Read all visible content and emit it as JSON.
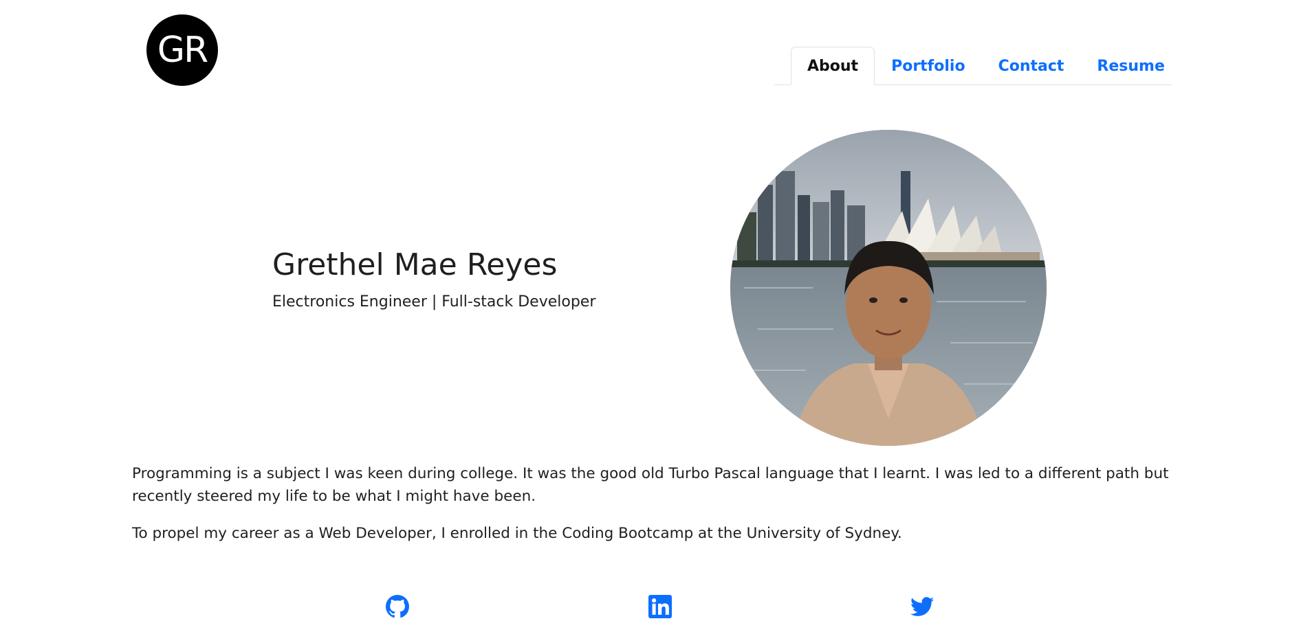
{
  "header": {
    "logo_text": "GR",
    "nav": [
      {
        "label": "About",
        "active": true
      },
      {
        "label": "Portfolio",
        "active": false
      },
      {
        "label": "Contact",
        "active": false
      },
      {
        "label": "Resume",
        "active": false
      }
    ]
  },
  "hero": {
    "name": "Grethel Mae Reyes",
    "tagline": "Electronics Engineer | Full-stack Developer",
    "photo_icon": "profile-photo-sydney-opera-house"
  },
  "about": {
    "paragraphs": [
      "Programming is a subject I was keen during college. It was the good old Turbo Pascal language that I learnt. I was led to a different path but recently steered my life to be what I might have been.",
      "To propel my career as a Web Developer, I enrolled in the Coding Bootcamp at the University of Sydney."
    ]
  },
  "social": {
    "icons": [
      "github-icon",
      "linkedin-icon",
      "twitter-icon"
    ]
  },
  "colors": {
    "accent": "#0d6efd",
    "text": "#1f1f1f",
    "logo_bg": "#000000",
    "nav_border": "#dee2e6"
  }
}
